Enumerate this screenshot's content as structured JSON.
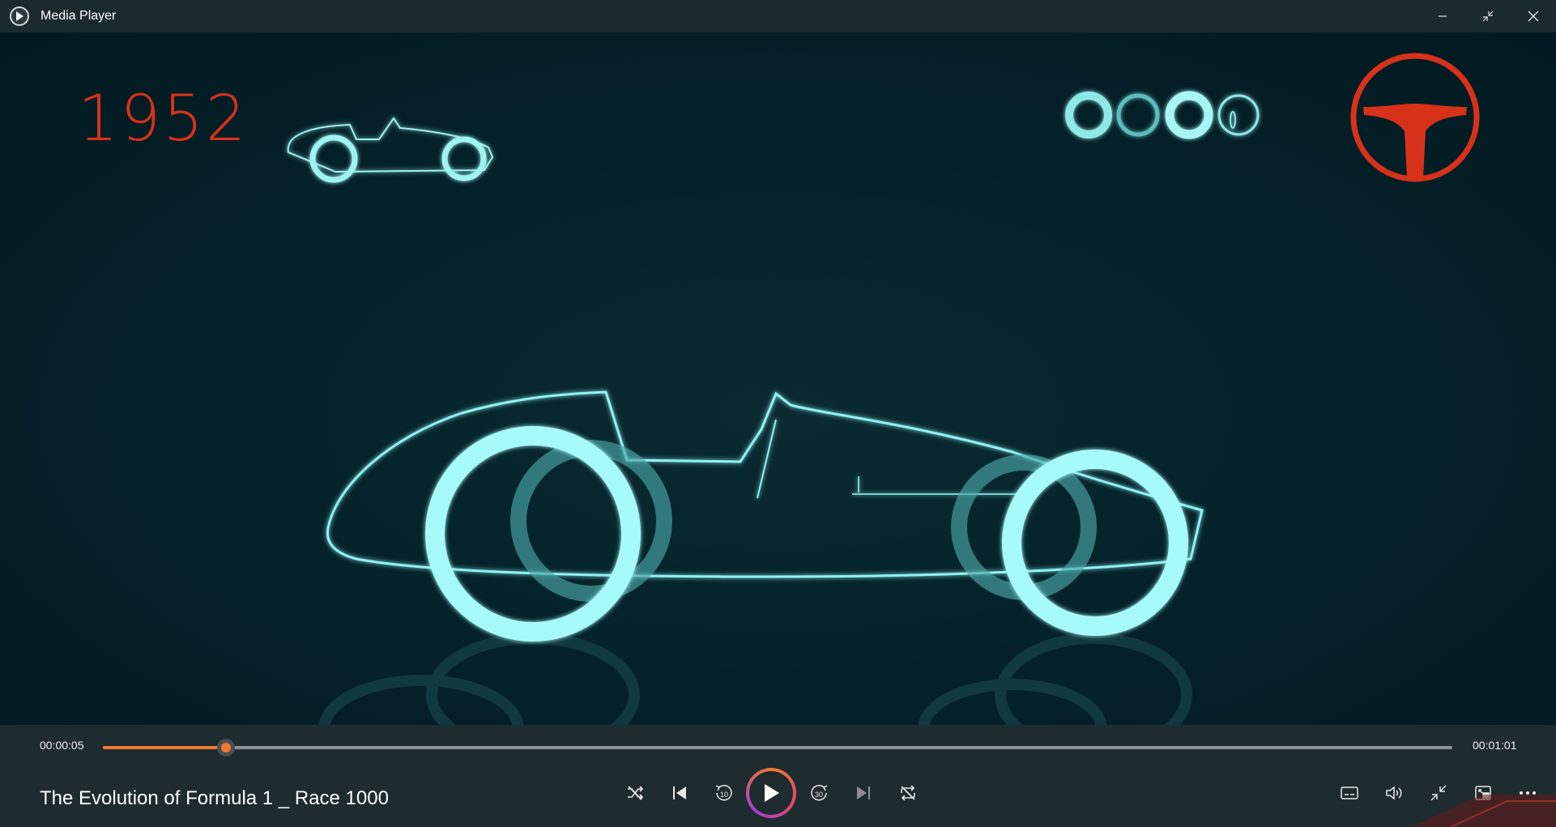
{
  "window": {
    "title": "Media Player",
    "icon": "play-circle-icon"
  },
  "window_controls": {
    "minimize": "minimize-icon",
    "restore": "restore-icon",
    "close": "close-icon"
  },
  "video": {
    "overlay_year": "1952",
    "accent_color": "#d8311a",
    "line_color": "#8ff2f0"
  },
  "playback": {
    "current_time": "00:00:05",
    "total_time": "00:01:01",
    "progress": 0.091,
    "progress_color": "#f07a32"
  },
  "media": {
    "title": "The Evolution of Formula 1 _ Race 1000"
  },
  "transport": {
    "shuffle": "shuffle-off-icon",
    "previous": "skip-previous-icon",
    "rewind": "rewind-10-icon",
    "rewind_label": "10",
    "play": "play-icon",
    "forward": "forward-30-icon",
    "forward_label": "30",
    "next": "skip-next-icon",
    "repeat": "repeat-off-icon"
  },
  "tools": {
    "captions": "captions-icon",
    "volume": "volume-icon",
    "exit_fullscreen": "exit-fullscreen-icon",
    "mini_player": "mini-player-icon",
    "more": "more-icon"
  }
}
